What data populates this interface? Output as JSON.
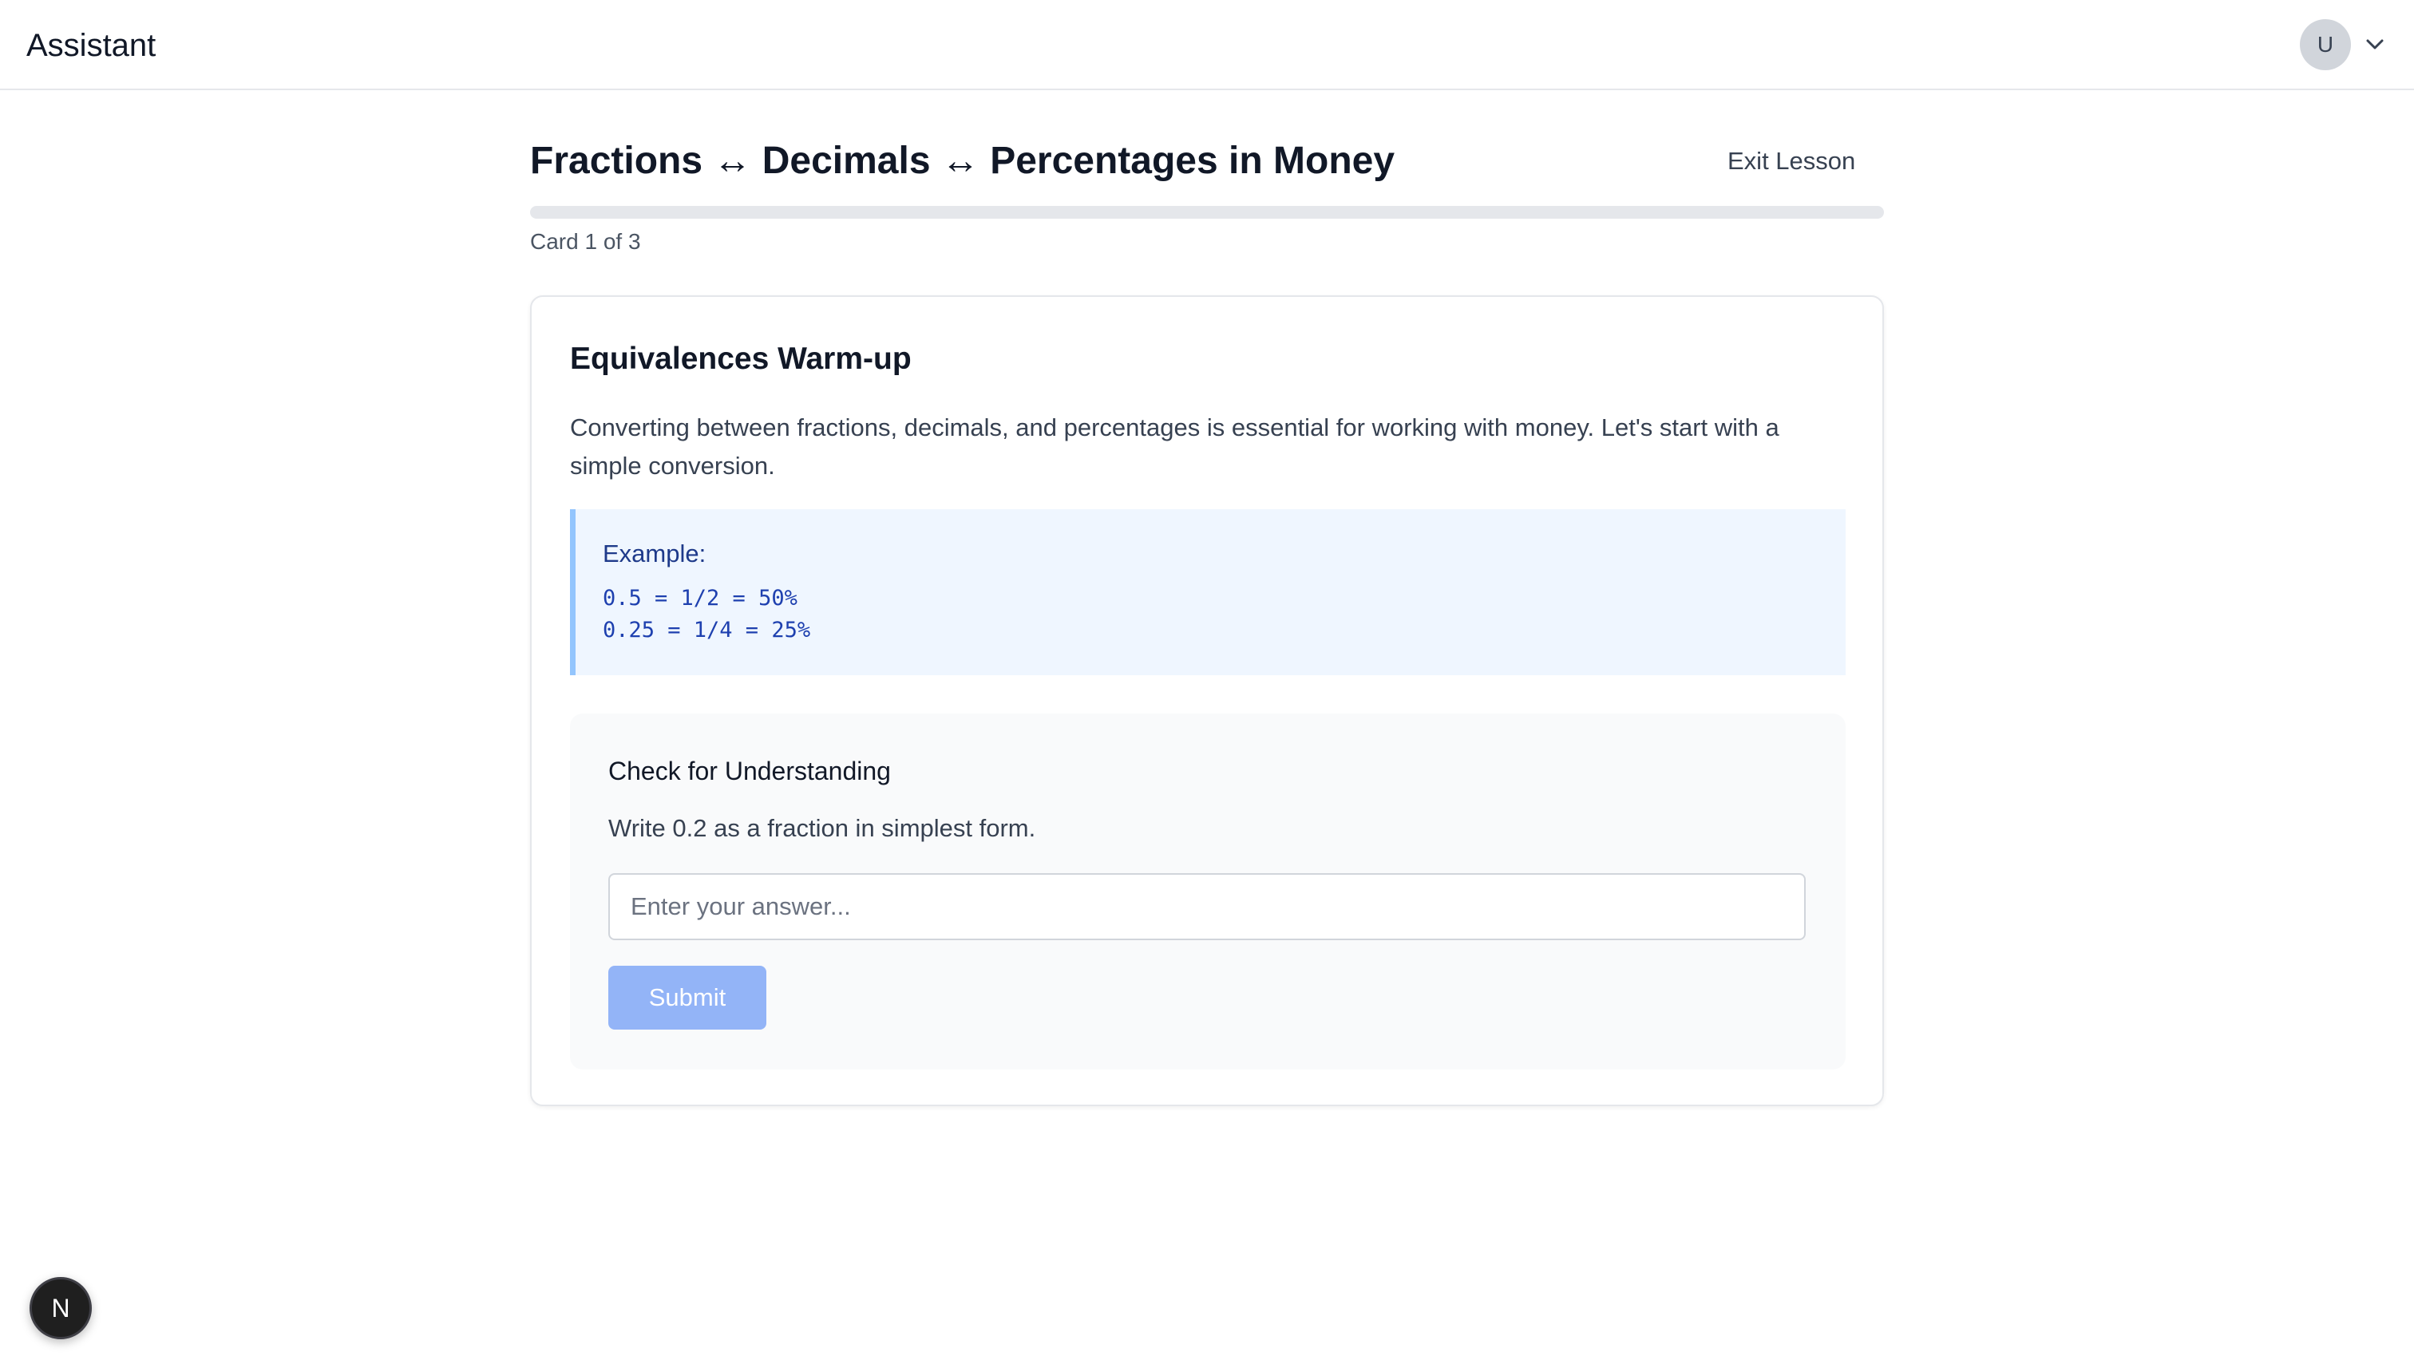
{
  "header": {
    "app_title": "Assistant",
    "avatar_initial": "U",
    "avatar_menu_icon": "chevron-down-icon"
  },
  "lesson": {
    "title": "Fractions ↔ Decimals ↔ Percentages in Money",
    "exit_label": "Exit Lesson",
    "progress_fraction": 0,
    "card_counter": "Card 1 of 3"
  },
  "card": {
    "title": "Equivalences Warm-up",
    "description": "Converting between fractions, decimals, and percentages is essential for working with money. Let's start with a simple conversion.",
    "example": {
      "label": "Example:",
      "lines": [
        "0.5 = 1/2 = 50%",
        "0.25 = 1/4 = 25%"
      ]
    },
    "check": {
      "title": "Check for Understanding",
      "question": "Write 0.2 as a fraction in simplest form.",
      "input_value": "",
      "input_placeholder": "Enter your answer...",
      "submit_label": "Submit"
    }
  },
  "dev_badge": {
    "letter": "N"
  },
  "colors": {
    "accent": "#3b82f6",
    "submit_disabled": "#93b4f7",
    "example_bg": "#eff6ff",
    "example_border": "#93c5fd",
    "example_text": "#1e40af"
  }
}
